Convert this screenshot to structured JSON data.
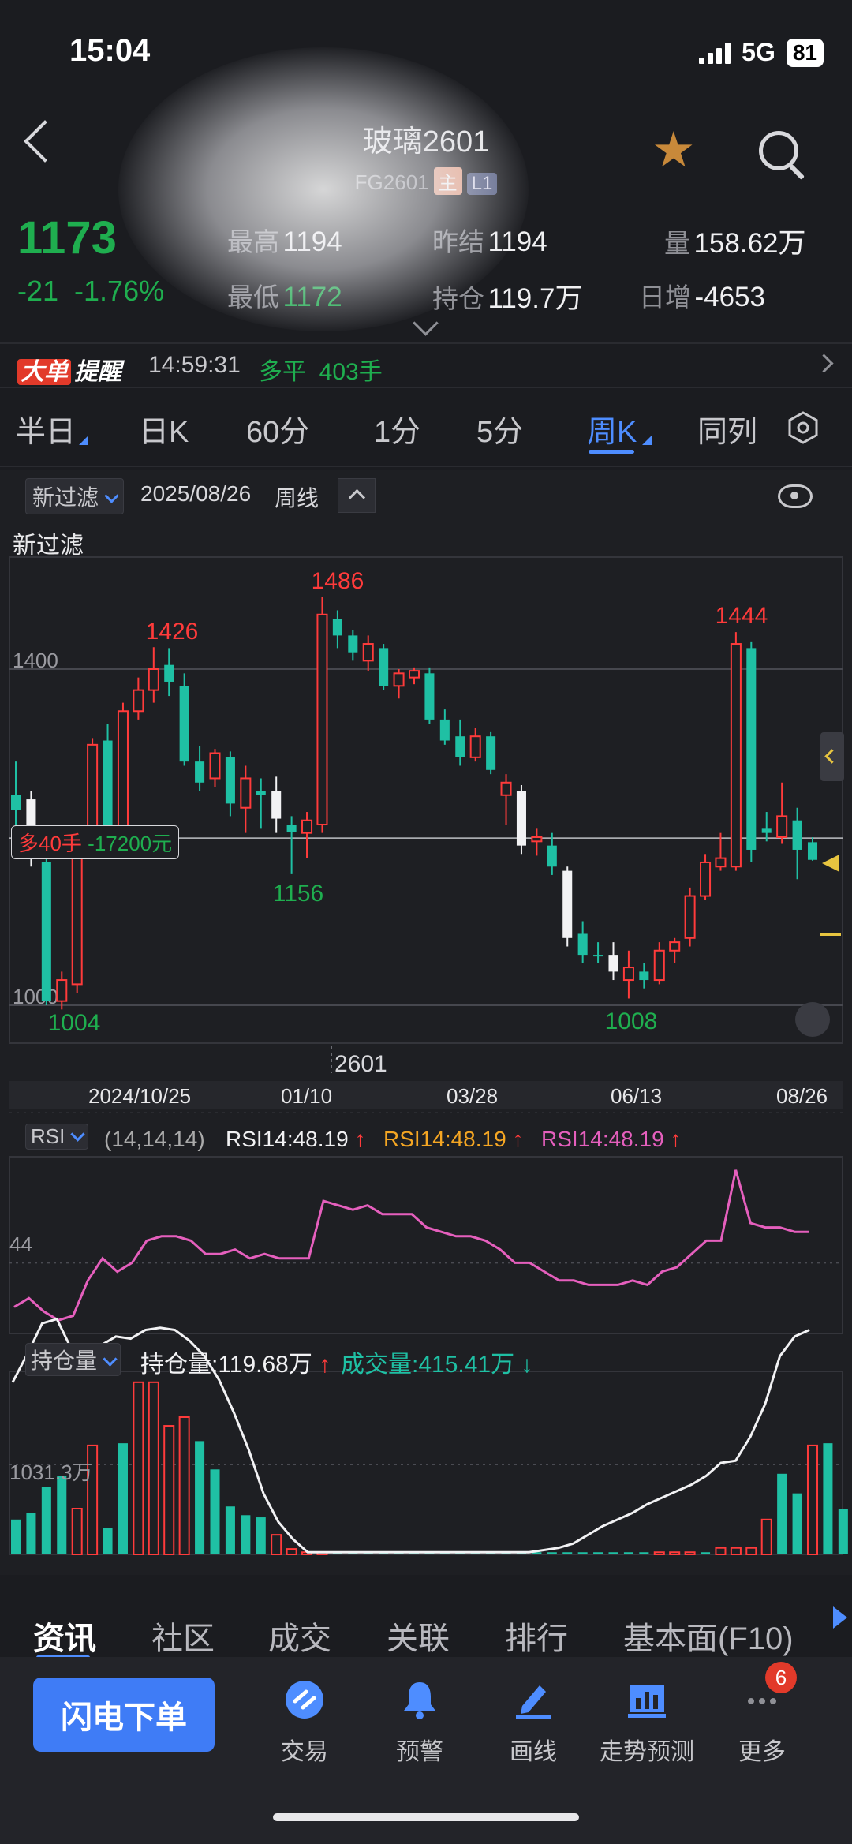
{
  "status_bar": {
    "time": "15:04",
    "network": "5G",
    "battery": "81"
  },
  "header": {
    "title": "玻璃2601",
    "code": "FG2601",
    "tag_main": "主",
    "tag_level": "L1"
  },
  "quote": {
    "price": "1173",
    "change": "-21",
    "change_pct": "-1.76%",
    "high_label": "最高",
    "high": "1194",
    "low_label": "最低",
    "low": "1172",
    "prev_settle_label": "昨结",
    "prev_settle": "1194",
    "open_interest_label": "持仓",
    "open_interest": "119.7万",
    "volume_label": "量",
    "volume": "158.62万",
    "daily_add_label": "日增",
    "daily_add": "-4653"
  },
  "alert": {
    "badge_1": "大单",
    "badge_2": "提醒",
    "time": "14:59:31",
    "action": "多平",
    "lots": "403手"
  },
  "period_tabs": [
    "半日",
    "日K",
    "60分",
    "1分",
    "5分",
    "周K",
    "同列"
  ],
  "active_period": "周K",
  "chart_toolbar": {
    "filter": "新过滤",
    "date": "2025/08/26",
    "period": "周线",
    "filter_title": "新过滤"
  },
  "position_marker": {
    "text_prefix": "多",
    "lots": "40手",
    "pnl": "-17200元"
  },
  "contract_marker": "2601",
  "indicator_rsi": {
    "name": "RSI",
    "params": "(14,14,14)",
    "values": [
      "RSI14:48.19",
      "RSI14:48.19",
      "RSI14:48.19"
    ],
    "axis_label": "44"
  },
  "indicator_oi": {
    "name": "持仓量",
    "oi_text": "持仓量:119.68万",
    "vol_text": "成交量:415.41万",
    "axis_label": "1031.3万"
  },
  "chart_data": {
    "type": "candlestick",
    "price_axis_ticks": [
      1400,
      1000
    ],
    "x_tick_labels": [
      "2024/10/25",
      "01/10",
      "03/28",
      "06/13",
      "08/26"
    ],
    "annotations": {
      "high_1": "1426",
      "high_2": "1486",
      "high_3": "1444",
      "low_1": "1004",
      "low_2": "1156",
      "low_3": "1008"
    },
    "ylim": [
      975,
      1510
    ],
    "candles": [
      {
        "o": 1250,
        "h": 1290,
        "l": 1215,
        "c": 1232
      },
      {
        "o": 1245,
        "h": 1255,
        "l": 1165,
        "c": 1180
      },
      {
        "o": 1170,
        "h": 1180,
        "l": 1000,
        "c": 1005
      },
      {
        "o": 1005,
        "h": 1040,
        "l": 995,
        "c": 1030
      },
      {
        "o": 1025,
        "h": 1210,
        "l": 1015,
        "c": 1200
      },
      {
        "o": 1200,
        "h": 1318,
        "l": 1195,
        "c": 1310
      },
      {
        "o": 1315,
        "h": 1335,
        "l": 1190,
        "c": 1205
      },
      {
        "o": 1205,
        "h": 1360,
        "l": 1198,
        "c": 1350
      },
      {
        "o": 1350,
        "h": 1390,
        "l": 1340,
        "c": 1375
      },
      {
        "o": 1375,
        "h": 1426,
        "l": 1360,
        "c": 1400
      },
      {
        "o": 1405,
        "h": 1425,
        "l": 1368,
        "c": 1385
      },
      {
        "o": 1380,
        "h": 1395,
        "l": 1285,
        "c": 1290
      },
      {
        "o": 1290,
        "h": 1308,
        "l": 1255,
        "c": 1265
      },
      {
        "o": 1270,
        "h": 1305,
        "l": 1260,
        "c": 1300
      },
      {
        "o": 1295,
        "h": 1302,
        "l": 1225,
        "c": 1240
      },
      {
        "o": 1235,
        "h": 1285,
        "l": 1205,
        "c": 1270
      },
      {
        "o": 1255,
        "h": 1270,
        "l": 1210,
        "c": 1250
      },
      {
        "o": 1255,
        "h": 1272,
        "l": 1205,
        "c": 1222
      },
      {
        "o": 1215,
        "h": 1225,
        "l": 1156,
        "c": 1206
      },
      {
        "o": 1205,
        "h": 1230,
        "l": 1175,
        "c": 1220
      },
      {
        "o": 1215,
        "h": 1486,
        "l": 1205,
        "c": 1465
      },
      {
        "o": 1460,
        "h": 1470,
        "l": 1425,
        "c": 1440
      },
      {
        "o": 1440,
        "h": 1446,
        "l": 1410,
        "c": 1420
      },
      {
        "o": 1410,
        "h": 1440,
        "l": 1398,
        "c": 1430
      },
      {
        "o": 1425,
        "h": 1430,
        "l": 1375,
        "c": 1380
      },
      {
        "o": 1380,
        "h": 1400,
        "l": 1365,
        "c": 1395
      },
      {
        "o": 1390,
        "h": 1402,
        "l": 1382,
        "c": 1398
      },
      {
        "o": 1395,
        "h": 1402,
        "l": 1335,
        "c": 1340
      },
      {
        "o": 1340,
        "h": 1352,
        "l": 1310,
        "c": 1315
      },
      {
        "o": 1320,
        "h": 1340,
        "l": 1285,
        "c": 1295
      },
      {
        "o": 1295,
        "h": 1330,
        "l": 1290,
        "c": 1320
      },
      {
        "o": 1320,
        "h": 1325,
        "l": 1275,
        "c": 1280
      },
      {
        "o": 1250,
        "h": 1275,
        "l": 1215,
        "c": 1265
      },
      {
        "o": 1255,
        "h": 1262,
        "l": 1180,
        "c": 1190
      },
      {
        "o": 1195,
        "h": 1210,
        "l": 1178,
        "c": 1200
      },
      {
        "o": 1190,
        "h": 1205,
        "l": 1155,
        "c": 1165
      },
      {
        "o": 1160,
        "h": 1165,
        "l": 1070,
        "c": 1080
      },
      {
        "o": 1085,
        "h": 1100,
        "l": 1050,
        "c": 1060
      },
      {
        "o": 1060,
        "h": 1075,
        "l": 1050,
        "c": 1060
      },
      {
        "o": 1060,
        "h": 1075,
        "l": 1030,
        "c": 1040
      },
      {
        "o": 1030,
        "h": 1065,
        "l": 1008,
        "c": 1045
      },
      {
        "o": 1040,
        "h": 1050,
        "l": 1020,
        "c": 1030
      },
      {
        "o": 1030,
        "h": 1075,
        "l": 1025,
        "c": 1065
      },
      {
        "o": 1065,
        "h": 1080,
        "l": 1050,
        "c": 1075
      },
      {
        "o": 1080,
        "h": 1140,
        "l": 1070,
        "c": 1130
      },
      {
        "o": 1130,
        "h": 1180,
        "l": 1125,
        "c": 1170
      },
      {
        "o": 1165,
        "h": 1205,
        "l": 1160,
        "c": 1175
      },
      {
        "o": 1165,
        "h": 1444,
        "l": 1160,
        "c": 1430
      },
      {
        "o": 1425,
        "h": 1432,
        "l": 1170,
        "c": 1185
      },
      {
        "o": 1210,
        "h": 1230,
        "l": 1195,
        "c": 1205
      },
      {
        "o": 1200,
        "h": 1265,
        "l": 1192,
        "c": 1225
      },
      {
        "o": 1220,
        "h": 1235,
        "l": 1150,
        "c": 1185
      },
      {
        "o": 1194,
        "h": 1200,
        "l": 1172,
        "c": 1173
      }
    ],
    "rsi": [
      34,
      36,
      33,
      31,
      32,
      40,
      45,
      42,
      44,
      49,
      50,
      50,
      49,
      46,
      46,
      47,
      45,
      46,
      45,
      45,
      45,
      58,
      57,
      56,
      57,
      55,
      55,
      55,
      52,
      51,
      50,
      50,
      49,
      47,
      44,
      44,
      42,
      40,
      40,
      39,
      39,
      39,
      40,
      39,
      42,
      43,
      46,
      49,
      49,
      65,
      53,
      52,
      52,
      51,
      51
    ],
    "volume_bars": [
      {
        "v": 1.6,
        "c": "t"
      },
      {
        "v": 1.9,
        "c": "t"
      },
      {
        "v": 3.1,
        "c": "t"
      },
      {
        "v": 3.6,
        "c": "t"
      },
      {
        "v": 2.1,
        "c": "r"
      },
      {
        "v": 5.0,
        "c": "r"
      },
      {
        "v": 1.2,
        "c": "t"
      },
      {
        "v": 5.1,
        "c": "t"
      },
      {
        "v": 7.9,
        "c": "r"
      },
      {
        "v": 7.9,
        "c": "r"
      },
      {
        "v": 5.9,
        "c": "r"
      },
      {
        "v": 6.3,
        "c": "r"
      },
      {
        "v": 5.2,
        "c": "t"
      },
      {
        "v": 3.9,
        "c": "t"
      },
      {
        "v": 2.2,
        "c": "t"
      },
      {
        "v": 1.8,
        "c": "t"
      },
      {
        "v": 1.7,
        "c": "t"
      },
      {
        "v": 0.9,
        "c": "r"
      },
      {
        "v": 0.25,
        "c": "r"
      },
      {
        "v": 0.1,
        "c": "r"
      },
      {
        "v": 0.1,
        "c": "r"
      },
      {
        "v": 0.1,
        "c": "t"
      },
      {
        "v": 0.1,
        "c": "t"
      },
      {
        "v": 0.1,
        "c": "t"
      },
      {
        "v": 0.1,
        "c": "t"
      },
      {
        "v": 0.1,
        "c": "t"
      },
      {
        "v": 0.1,
        "c": "t"
      },
      {
        "v": 0.1,
        "c": "t"
      },
      {
        "v": 0.1,
        "c": "t"
      },
      {
        "v": 0.1,
        "c": "t"
      },
      {
        "v": 0.1,
        "c": "t"
      },
      {
        "v": 0.1,
        "c": "t"
      },
      {
        "v": 0.1,
        "c": "t"
      },
      {
        "v": 0.1,
        "c": "t"
      },
      {
        "v": 0.1,
        "c": "t"
      },
      {
        "v": 0.1,
        "c": "t"
      },
      {
        "v": 0.1,
        "c": "t"
      },
      {
        "v": 0.1,
        "c": "t"
      },
      {
        "v": 0.1,
        "c": "t"
      },
      {
        "v": 0.1,
        "c": "t"
      },
      {
        "v": 0.1,
        "c": "t"
      },
      {
        "v": 0.1,
        "c": "t"
      },
      {
        "v": 0.1,
        "c": "r"
      },
      {
        "v": 0.1,
        "c": "r"
      },
      {
        "v": 0.1,
        "c": "r"
      },
      {
        "v": 0.1,
        "c": "t"
      },
      {
        "v": 0.3,
        "c": "r"
      },
      {
        "v": 0.3,
        "c": "r"
      },
      {
        "v": 0.3,
        "c": "r"
      },
      {
        "v": 1.6,
        "c": "r"
      },
      {
        "v": 3.7,
        "c": "t"
      },
      {
        "v": 2.8,
        "c": "t"
      },
      {
        "v": 5.0,
        "c": "r"
      },
      {
        "v": 5.1,
        "c": "t"
      },
      {
        "v": 2.1,
        "c": "t"
      }
    ],
    "open_interest_line": [
      7.9,
      9.2,
      10.6,
      10.8,
      9.4,
      8.5,
      9.6,
      10.0,
      9.9,
      10.3,
      10.4,
      10.3,
      9.8,
      9.1,
      8.0,
      6.5,
      4.8,
      2.8,
      1.5,
      0.7,
      0.1,
      0.1,
      0.1,
      0.1,
      0.1,
      0.1,
      0.1,
      0.1,
      0.1,
      0.1,
      0.1,
      0.1,
      0.1,
      0.1,
      0.1,
      0.1,
      0.2,
      0.3,
      0.5,
      0.9,
      1.3,
      1.6,
      1.9,
      2.3,
      2.6,
      2.9,
      3.2,
      3.6,
      4.2,
      4.3,
      5.4,
      6.9,
      9.1,
      10.0,
      10.3
    ]
  },
  "bottom_tabs": [
    "资讯",
    "社区",
    "成交",
    "关联",
    "排行",
    "基本面(F10)"
  ],
  "bottom_nav": {
    "flash_order": "闪电下单",
    "items": [
      {
        "label": "交易",
        "icon": "trade-icon"
      },
      {
        "label": "预警",
        "icon": "bell-icon"
      },
      {
        "label": "画线",
        "icon": "pen-icon"
      },
      {
        "label": "走势预测",
        "icon": "chart-icon"
      },
      {
        "label": "更多",
        "icon": "more-icon"
      }
    ],
    "more_badge": "6"
  }
}
